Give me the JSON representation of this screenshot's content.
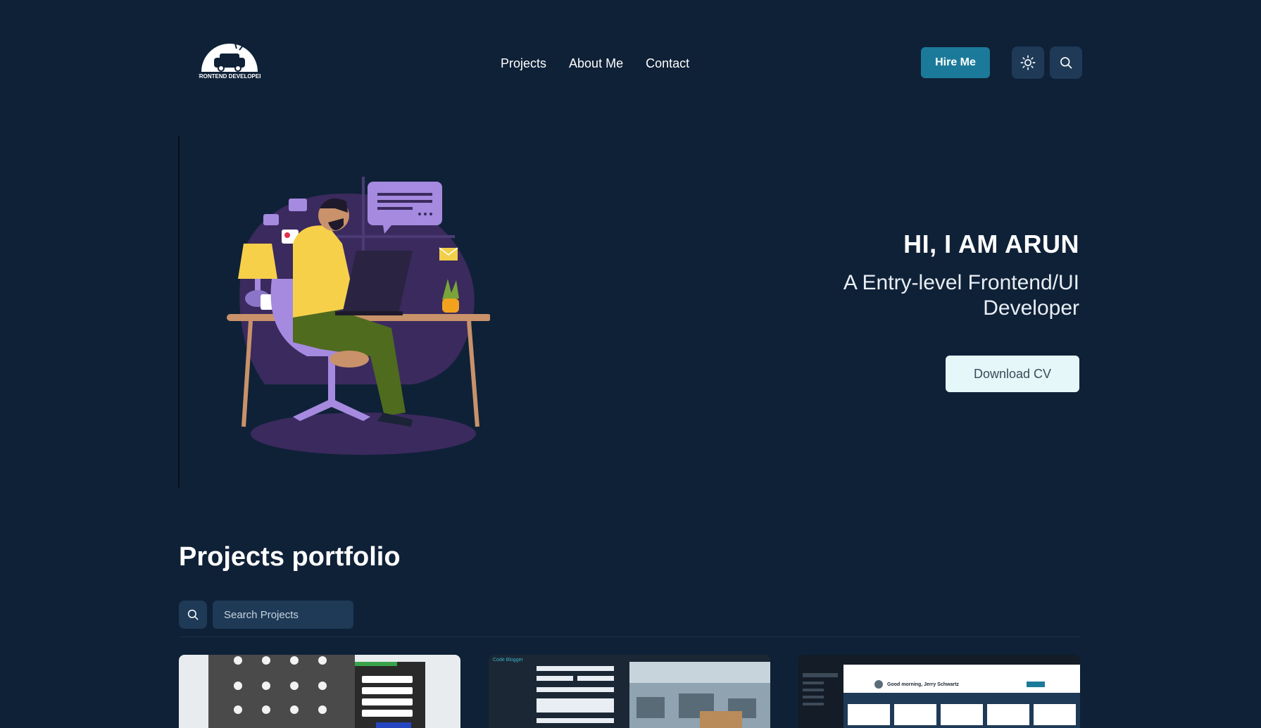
{
  "header": {
    "logo_text": "FRONTEND DEVELOPER",
    "nav": [
      "Projects",
      "About Me",
      "Contact"
    ],
    "hire_label": "Hire Me",
    "theme_icon": "sun-icon",
    "search_icon": "search-icon"
  },
  "hero": {
    "title": "HI, I AM ARUN",
    "subtitle": "A Entry-level Frontend/UI Developer",
    "cv_label": "Download CV"
  },
  "projects": {
    "title": "Projects portfolio",
    "search_placeholder": "Search Projects",
    "cards": [
      {
        "brand": ""
      },
      {
        "brand": "Code Blogger"
      },
      {
        "brand": "",
        "greeting": "Good morning, Jerry Schwartz"
      }
    ]
  },
  "colors": {
    "background": "#0f2137",
    "accent": "#1b7a9a",
    "panel": "#1e3a57",
    "cv_button": "#e6f7fa"
  }
}
